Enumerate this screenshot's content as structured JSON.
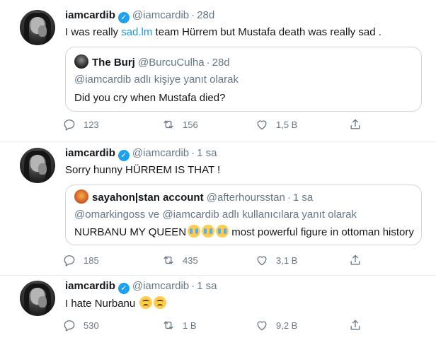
{
  "colors": {
    "accent": "#1da1f2",
    "link": "#1b95e0",
    "secondary_text": "#657786",
    "border": "#ccd6dd"
  },
  "tweets": [
    {
      "name": "iamcardib",
      "handle": "@iamcardib",
      "time": "28d",
      "text_before": "I was really ",
      "text_link": "sad.lm",
      "text_after": " team Hürrem but Mustafa death was really sad .",
      "quote": {
        "name": "The Burj",
        "handle": "@BurcuCulha",
        "time": "28d",
        "replying": "@iamcardib adlı kişiye yanıt olarak",
        "text": "Did you cry when Mustafa died?"
      },
      "stats": {
        "replies": "123",
        "retweets": "156",
        "likes": "1,5 B"
      }
    },
    {
      "name": "iamcardib",
      "handle": "@iamcardib",
      "time": "1 sa",
      "text": "Sorry hunny HÜRREM IS THAT !",
      "quote": {
        "name": "sayahon|stan account",
        "handle": "@afterhoursstan",
        "time": "1 sa",
        "replying": "@omarkingoss ve @iamcardib adlı kullanıcılara yanıt olarak",
        "text_before": "NURBANU MY QUEEN",
        "text_after": " most powerful figure in ottoman history"
      },
      "stats": {
        "replies": "185",
        "retweets": "435",
        "likes": "3,1 B"
      }
    },
    {
      "name": "iamcardib",
      "handle": "@iamcardib",
      "time": "1 sa",
      "text": "I hate Nurbanu",
      "stats": {
        "replies": "530",
        "retweets": "1 B",
        "likes": "9,2 B"
      }
    }
  ],
  "icons": {
    "verified": "verified-badge-icon",
    "reply": "reply-icon",
    "retweet": "retweet-icon",
    "like": "heart-icon",
    "share": "share-icon",
    "cry_emoji": "loudly-crying-face-emoji",
    "sad_emoji": "pensive-face-emoji"
  }
}
